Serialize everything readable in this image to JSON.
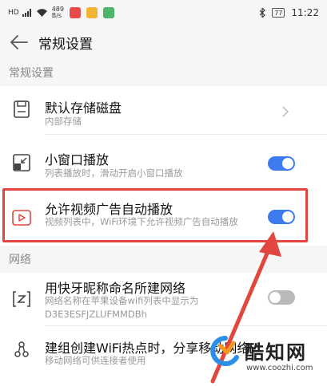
{
  "status_bar": {
    "network_left": "HD",
    "net_speed_value": "489",
    "net_speed_unit": "B/s",
    "battery": "77",
    "time": "11:22"
  },
  "header": {
    "title": "常规设置"
  },
  "sections": [
    {
      "label": "常规设置"
    },
    {
      "label": "网络"
    }
  ],
  "settings": {
    "storage": {
      "title": "默认存储磁盘",
      "subtitle": "内部存储"
    },
    "mini_window": {
      "title": "小窗口播放",
      "subtitle": "列表播放时，滑动开启小窗口播放",
      "enabled": true
    },
    "video_ad_autoplay": {
      "title": "允许视频广告自动播放",
      "subtitle": "视频列表中，WiFi环境下允许视频广告自动播放",
      "enabled": true
    },
    "quick_tooth_network": {
      "title": "用快牙昵称命名所建网络",
      "subtitle": "网络名称在苹果设备wifi列表中显示为\nD3E3ESFJZLUFMMDBh",
      "enabled": false
    },
    "hotspot_share": {
      "title": "建组创建WiFi热点时，分享移动网络",
      "subtitle": "移动网络可供连接者使用"
    }
  },
  "watermark": {
    "brand": "酷知网",
    "url": "www.coozhi.com"
  },
  "colors": {
    "toggle_on": "#3d7cf0",
    "toggle_off": "#b9b9b9",
    "highlight": "#e1473e",
    "section_bg": "#f6f6f6"
  }
}
